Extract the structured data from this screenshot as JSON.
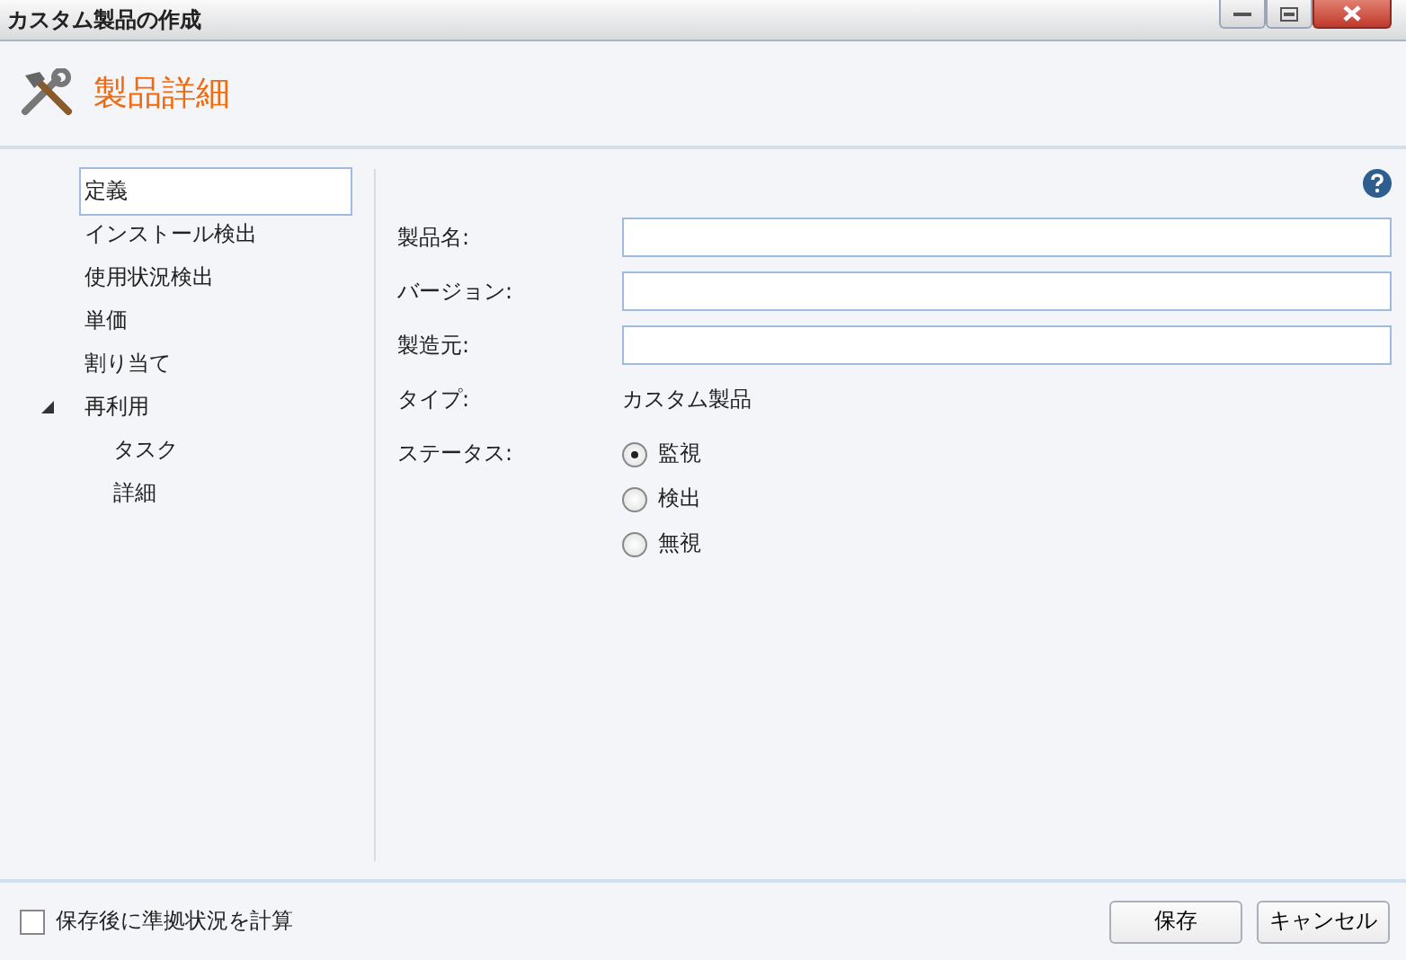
{
  "window": {
    "title": "カスタム製品の作成"
  },
  "header": {
    "title": "製品詳細"
  },
  "sidebar": {
    "items": [
      {
        "label": "定義",
        "selected": true
      },
      {
        "label": "インストール検出",
        "selected": false
      },
      {
        "label": "使用状況検出",
        "selected": false
      },
      {
        "label": "単価",
        "selected": false
      },
      {
        "label": "割り当て",
        "selected": false
      },
      {
        "label": "再利用",
        "selected": false,
        "expanded": true,
        "children": [
          {
            "label": "タスク",
            "selected": false
          },
          {
            "label": "詳細",
            "selected": false
          }
        ]
      }
    ]
  },
  "form": {
    "fields": [
      {
        "kind": "input",
        "label": "製品名:"
      },
      {
        "kind": "input",
        "label": "バージョン:"
      },
      {
        "kind": "input",
        "label": "製造元:"
      },
      {
        "kind": "text",
        "label": "タイプ:",
        "value": "カスタム製品"
      },
      {
        "kind": "radio",
        "label": "ステータス:",
        "options": [
          {
            "label": "監視",
            "selected": true
          },
          {
            "label": "検出",
            "selected": false
          },
          {
            "label": "無視",
            "selected": false
          }
        ]
      }
    ]
  },
  "footer": {
    "checkbox": {
      "label": "保存後に準拠状況を計算",
      "checked": false
    },
    "buttons": [
      "保存",
      "キャンセル"
    ]
  }
}
